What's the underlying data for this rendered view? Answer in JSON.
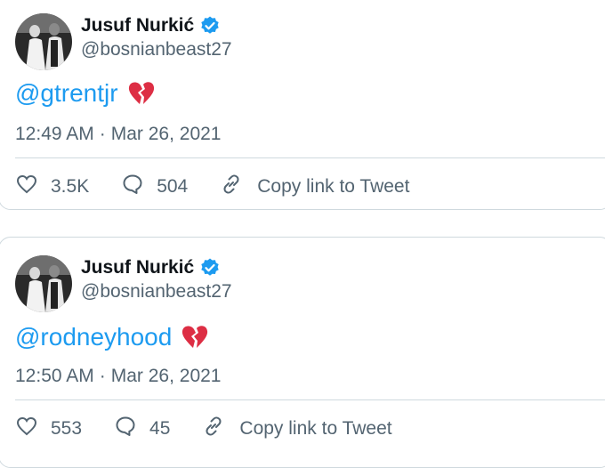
{
  "tweets": [
    {
      "author": {
        "name": "Jusuf Nurkić",
        "handle": "@bosnianbeast27"
      },
      "mention": "@gtrentjr",
      "emoji": "broken-heart",
      "time": "12:49 AM",
      "separator": "·",
      "date": "Mar 26, 2021",
      "likes": "3.5K",
      "replies": "504",
      "copy_link_label": "Copy link to Tweet"
    },
    {
      "author": {
        "name": "Jusuf Nurkić",
        "handle": "@bosnianbeast27"
      },
      "mention": "@rodneyhood",
      "emoji": "broken-heart",
      "time": "12:50 AM",
      "separator": "·",
      "date": "Mar 26, 2021",
      "likes": "553",
      "replies": "45",
      "copy_link_label": "Copy link to Tweet"
    }
  ],
  "colors": {
    "link_blue": "#1d9bf0",
    "secondary_text": "#536471",
    "border": "#cfd9de",
    "verified": "#1d9bf0",
    "heart_red": "#dd2e44"
  },
  "icons": {
    "like": "heart-outline-icon",
    "reply": "speech-bubble-icon",
    "copy_link": "link-icon",
    "verified": "verified-badge-icon"
  }
}
